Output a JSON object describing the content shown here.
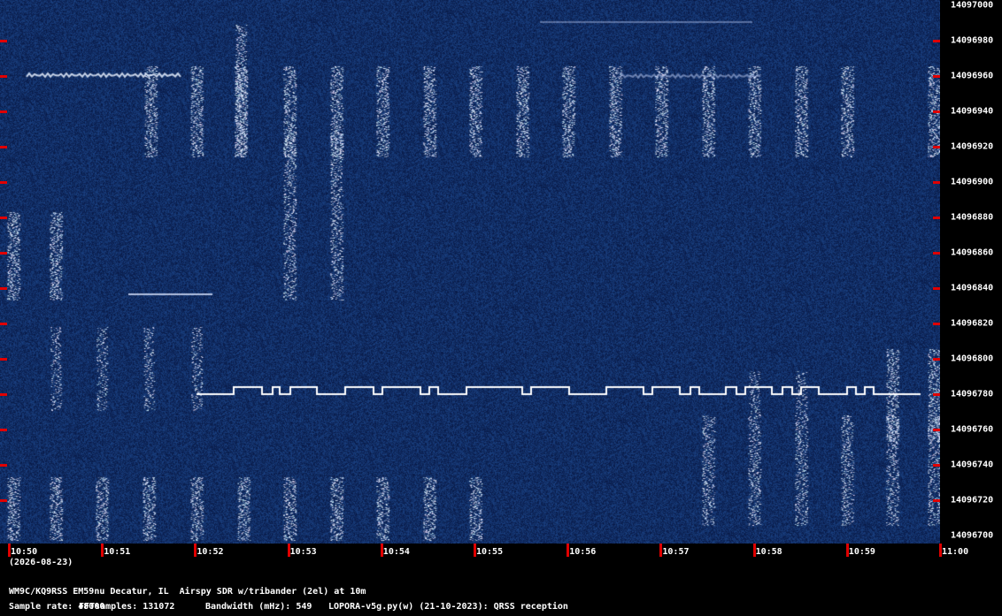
{
  "frequency_labels": [
    "14097000",
    "14096980",
    "14096960",
    "14096940",
    "14096920",
    "14096900",
    "14096880",
    "14096860",
    "14096840",
    "14096820",
    "14096800",
    "14096780",
    "14096760",
    "14096740",
    "14096720",
    "14096700"
  ],
  "time_labels": [
    "10:50",
    "10:51",
    "10:52",
    "10:53",
    "10:54",
    "10:55",
    "10:56",
    "10:57",
    "10:58",
    "10:59",
    "11:00"
  ],
  "date_label": "(2026-08-23)",
  "footer": {
    "station": "WM9C/KQ9RSS EM59nu Decatur, IL  Airspy SDR w/tribander (2el) at 10m",
    "sample_rate": "Sample rate: 48000",
    "fft_samples": "FFTsamples: 131072",
    "bandwidth": "Bandwidth (mHz): 549",
    "software": "LOPORA-v5g.py(w) (21-10-2023): QRSS reception"
  },
  "colors": {
    "background": "#0a1f5c",
    "signal": "#ffffff",
    "tick": "#e00000"
  }
}
